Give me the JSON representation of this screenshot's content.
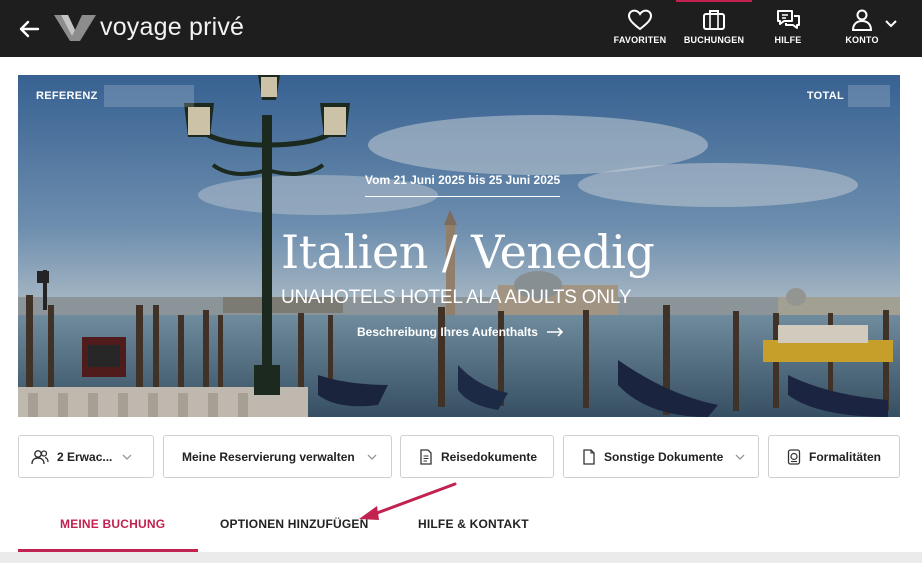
{
  "header": {
    "brand": "voyage privé",
    "nav": [
      {
        "label": "FAVORITEN",
        "icon": "heart-icon"
      },
      {
        "label": "BUCHUNGEN",
        "icon": "suitcase-icon"
      },
      {
        "label": "HILFE",
        "icon": "chat-bubbles-icon"
      },
      {
        "label": "KONTO",
        "icon": "user-icon"
      }
    ],
    "active_nav": "BUCHUNGEN"
  },
  "hero": {
    "ref_label": "REFERENZ",
    "total_label": "TOTAL",
    "dates": "Vom 21 Juni 2025 bis 25 Juni 2025",
    "destination": "Italien / Venedig",
    "hotel": "UNAHOTELS HOTEL ALA ADULTS ONLY",
    "description_link": "Beschreibung Ihres Aufenthalts"
  },
  "actions": [
    {
      "label": "2 Erwac...",
      "icon": "people-icon",
      "dropdown": true
    },
    {
      "label": "Meine Reservierung verwalten",
      "dropdown": true
    },
    {
      "label": "Reisedokumente",
      "icon": "document-icon",
      "dropdown": false
    },
    {
      "label": "Sonstige Dokumente",
      "icon": "file-icon",
      "dropdown": true
    },
    {
      "label": "Formalitäten",
      "icon": "passport-icon",
      "dropdown": false
    }
  ],
  "tabs": [
    {
      "label": "MEINE BUCHUNG",
      "active": true
    },
    {
      "label": "OPTIONEN HINZUFÜGEN",
      "active": false
    },
    {
      "label": "HILFE & KONTAKT",
      "active": false
    }
  ],
  "colors": {
    "accent": "#c1224f",
    "topbar": "#1e1e1e"
  }
}
